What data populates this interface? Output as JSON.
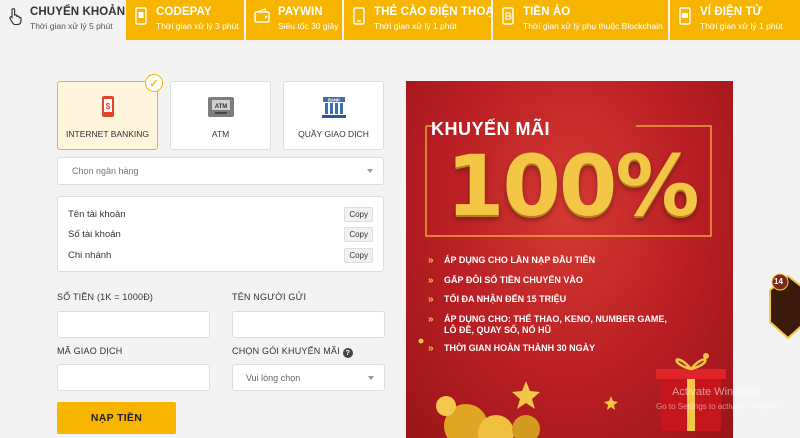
{
  "tabs": [
    {
      "name": "CHUYỂN KHOẢN",
      "sub": "Thời gian xử lý 5 phút",
      "icon": "hand-tap-icon",
      "active": true
    },
    {
      "name": "CODEPAY",
      "sub": "Thời gian xử lý 3 phút",
      "icon": "phone-pay-icon"
    },
    {
      "name": "PAYWIN",
      "sub": "Siêu tốc 30 giây",
      "icon": "wallet-icon"
    },
    {
      "name": "THẺ CÀO ĐIỆN THOẠI",
      "sub": "Thời gian xử lý 1 phút",
      "icon": "phone-card-icon"
    },
    {
      "name": "TIỀN ẢO",
      "sub": "Thời gian xử lý phụ thuộc Blockchain",
      "icon": "crypto-icon"
    },
    {
      "name": "VÍ ĐIỆN TỬ",
      "sub": "Thời gian xử lý 1 phút",
      "icon": "e-wallet-icon"
    }
  ],
  "methods": [
    {
      "label": "INTERNET BANKING",
      "active": true
    },
    {
      "label": "ATM"
    },
    {
      "label": "QUẦY GIAO DỊCH"
    }
  ],
  "bank_select": {
    "placeholder": "Chọn ngân hàng"
  },
  "account_info": {
    "rows": [
      {
        "label": "Tên tài khoản",
        "copy": "Copy"
      },
      {
        "label": "Số tài khoản",
        "copy": "Copy"
      },
      {
        "label": "Chi nhánh",
        "copy": "Copy"
      }
    ]
  },
  "form": {
    "amount_label": "SỐ TIỀN (1K = 1000Đ)",
    "sender_label": "TÊN NGƯỜI GỬI",
    "txn_label": "MÃ GIAO DỊCH",
    "promo_label": "CHỌN GÓI KHUYẾN MÃI",
    "promo_placeholder": "Vui lòng chọn",
    "submit": "NẠP TIỀN"
  },
  "banner": {
    "title": "KHUYẾN MÃI",
    "big": "100%",
    "bullets": [
      "ÁP DỤNG CHO LẦN NẠP ĐẦU TIÊN",
      "GẤP ĐÔI SỐ TIỀN CHUYỂN VÀO",
      "TỐI ĐA NHẬN ĐẾN 15 TRIỆU",
      "ÁP DỤNG CHO: THỂ THAO, KENO, NUMBER GAME, LÔ ĐỀ, QUAY SỐ, NỔ HŨ",
      "THỜI GIAN HOÀN THÀNH 30 NGÀY"
    ]
  },
  "watermark": {
    "line1": "Activate Windows",
    "line2": "Go to Settings to activate Windows."
  },
  "side_badge": {
    "count": "14"
  },
  "colors": {
    "accent": "#f7b500",
    "banner_red": "#b81e23",
    "gold": "#f3c646"
  }
}
